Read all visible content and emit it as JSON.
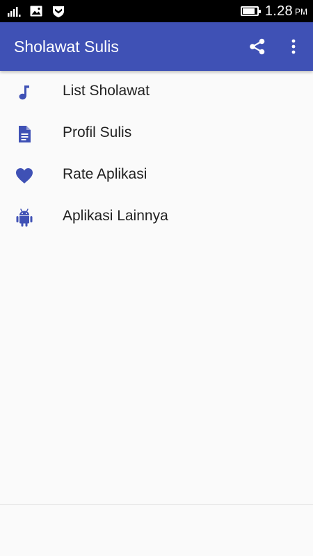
{
  "status_bar": {
    "time": "1.28",
    "ampm": "PM",
    "battery_level": 0.85,
    "icons": [
      "signal-icon",
      "image-notification-icon",
      "shield-notification-icon",
      "battery-icon"
    ]
  },
  "app_bar": {
    "title": "Sholawat Sulis",
    "actions": [
      "share-icon",
      "more-vert-icon"
    ]
  },
  "menu": {
    "items": [
      {
        "label": "List Sholawat",
        "icon": "music-note-icon"
      },
      {
        "label": "Profil Sulis",
        "icon": "document-icon"
      },
      {
        "label": "Rate Aplikasi",
        "icon": "heart-icon"
      },
      {
        "label": "Aplikasi Lainnya",
        "icon": "android-icon"
      }
    ]
  },
  "colors": {
    "primary": "#3f51b5",
    "icon": "#3f51b5",
    "background": "#fafafa",
    "text": "#212121",
    "status_bar": "#000000"
  }
}
